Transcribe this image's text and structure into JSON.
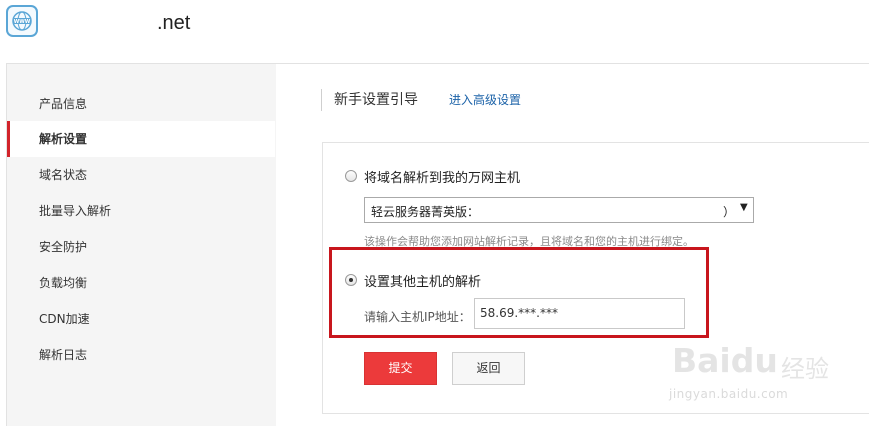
{
  "header": {
    "domain_text": ".net",
    "logo_icon": "www-globe-icon"
  },
  "sidebar": {
    "items": [
      {
        "label": "产品信息",
        "active": false
      },
      {
        "label": "解析设置",
        "active": true
      },
      {
        "label": "域名状态",
        "active": false
      },
      {
        "label": "批量导入解析",
        "active": false
      },
      {
        "label": "安全防护",
        "active": false
      },
      {
        "label": "负载均衡",
        "active": false
      },
      {
        "label": "CDN加速",
        "active": false
      },
      {
        "label": "解析日志",
        "active": false
      }
    ]
  },
  "main": {
    "title": "新手设置引导",
    "advanced_link": "进入高级设置",
    "option1": {
      "label": "将域名解析到我的万网主机",
      "checked": false,
      "select_value": "轻云服务器菁英版：",
      "select_suffix": "）",
      "hint": "该操作会帮助您添加网站解析记录，且将域名和您的主机进行绑定。"
    },
    "option2": {
      "label": "设置其他主机的解析",
      "checked": true,
      "ip_label": "请输入主机IP地址：",
      "ip_value": "58.69.***.***"
    },
    "buttons": {
      "submit": "提交",
      "back": "返回"
    }
  },
  "watermark": {
    "logo": "Baidu",
    "sub": "经验",
    "url": "jingyan.baidu.com"
  },
  "colors": {
    "accent_red": "#ec3a3b",
    "highlight_box": "#c8161d",
    "link_blue": "#1b62a8"
  }
}
